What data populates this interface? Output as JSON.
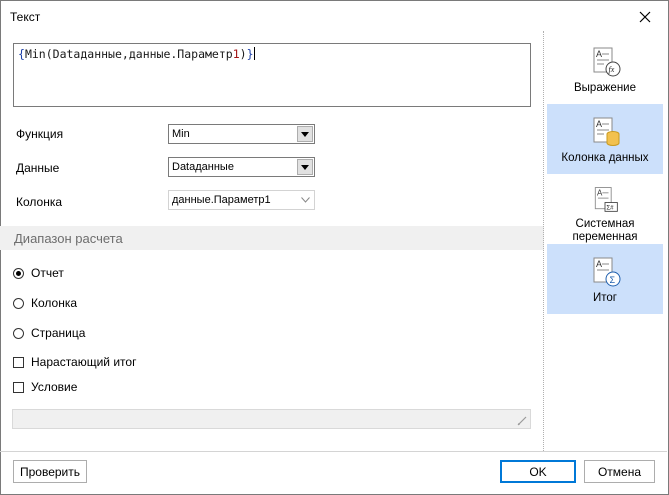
{
  "window": {
    "title": "Текст",
    "close_icon": "close-icon"
  },
  "expression": {
    "open_brace": "{",
    "func": "Min",
    "open_paren": "(",
    "arg1": "Dataданные",
    "comma": ",",
    "arg2_prefix": "данные.Параметр",
    "arg2_num": "1",
    "close_paren": ")",
    "close_brace": "}"
  },
  "fields": {
    "function_label": "Функция",
    "function_value": "Min",
    "data_label": "Данные",
    "data_value": "Dataданные",
    "column_label": "Колонка",
    "column_value": "данные.Параметр1"
  },
  "range": {
    "heading": "Диапазон расчета",
    "options": [
      {
        "label": "Отчет",
        "checked": true
      },
      {
        "label": "Колонка",
        "checked": false
      },
      {
        "label": "Страница",
        "checked": false
      }
    ]
  },
  "checks": {
    "running_total": "Нарастающий итог",
    "condition": "Условие"
  },
  "sidebar": {
    "items": [
      {
        "label": "Выражение",
        "icon": "expression-icon",
        "selected": false
      },
      {
        "label": "Колонка данных",
        "icon": "data-column-icon",
        "selected": true
      },
      {
        "label_line1": "Системная",
        "label_line2": "переменная",
        "icon": "system-variable-icon",
        "selected": false
      },
      {
        "label": "Итог",
        "icon": "summary-icon",
        "selected": true
      }
    ]
  },
  "footer": {
    "check_button": "Проверить",
    "ok_button": "OK",
    "cancel_button": "Отмена"
  },
  "colors": {
    "selection": "#cce0fb",
    "accent": "#0078d7",
    "section_bg": "#f0f0f0"
  }
}
